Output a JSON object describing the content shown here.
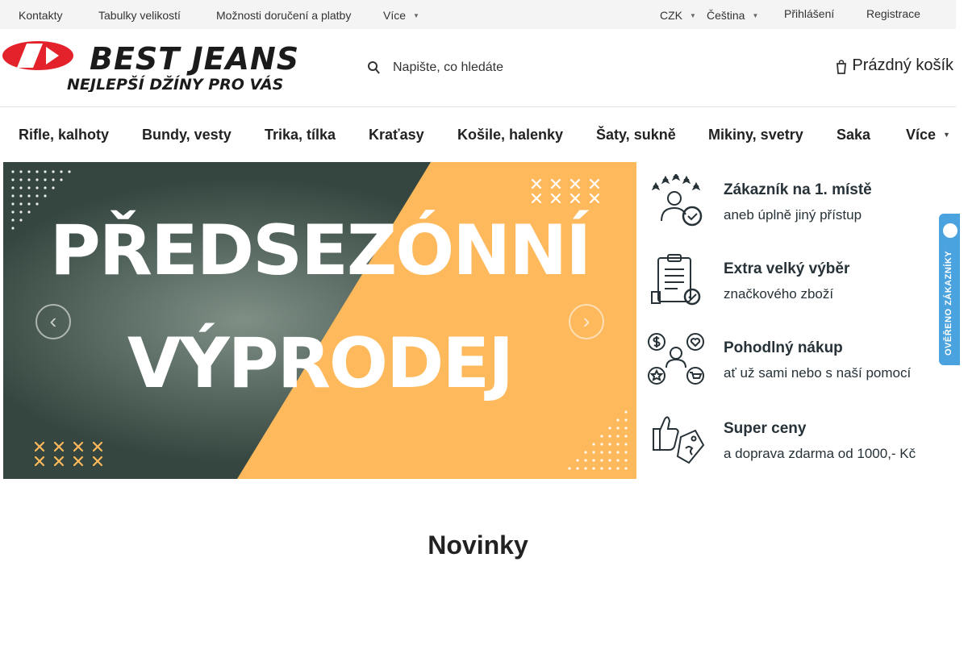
{
  "topbar": {
    "links": [
      "Kontakty",
      "Tabulky velikostí",
      "Možnosti doručení a platby",
      "Více"
    ],
    "currency": "CZK",
    "language": "Čeština",
    "login": "Přihlášení",
    "register": "Registrace"
  },
  "logo": {
    "brand": "BEST JEANS",
    "tagline": "NEJLEPŠÍ DŽÍNY PRO VÁS"
  },
  "search": {
    "placeholder": "Napište, co hledáte"
  },
  "cart": {
    "label": "Prázdný košík"
  },
  "categories": [
    "Rifle, kalhoty",
    "Bundy, vesty",
    "Trika, tílka",
    "Kraťasy",
    "Košile, halenky",
    "Šaty, sukně",
    "Mikiny, svetry",
    "Saka",
    "Více"
  ],
  "banner": {
    "line1": "PŘEDSEZÓNNÍ",
    "line2": "VÝPRODEJ",
    "colors": {
      "dark": "#34463f",
      "accent": "#fdb95c"
    }
  },
  "benefits": [
    {
      "title": "Zákazník na 1. místě",
      "subtitle": "aneb úplně jiný přístup",
      "icon": "customer-rating-icon"
    },
    {
      "title": "Extra velký výběr",
      "subtitle": "značkového zboží",
      "icon": "clipboard-check-icon"
    },
    {
      "title": "Pohodlný nákup",
      "subtitle": "ať už sami nebo s naší pomocí",
      "icon": "shopping-support-icon"
    },
    {
      "title": "Super ceny",
      "subtitle": "a doprava zdarma od 1000,- Kč",
      "icon": "price-tag-icon"
    }
  ],
  "verified_tab": {
    "label": "OVĚŘENO ZÁKAZNÍKY"
  },
  "section": {
    "title": "Novinky"
  }
}
